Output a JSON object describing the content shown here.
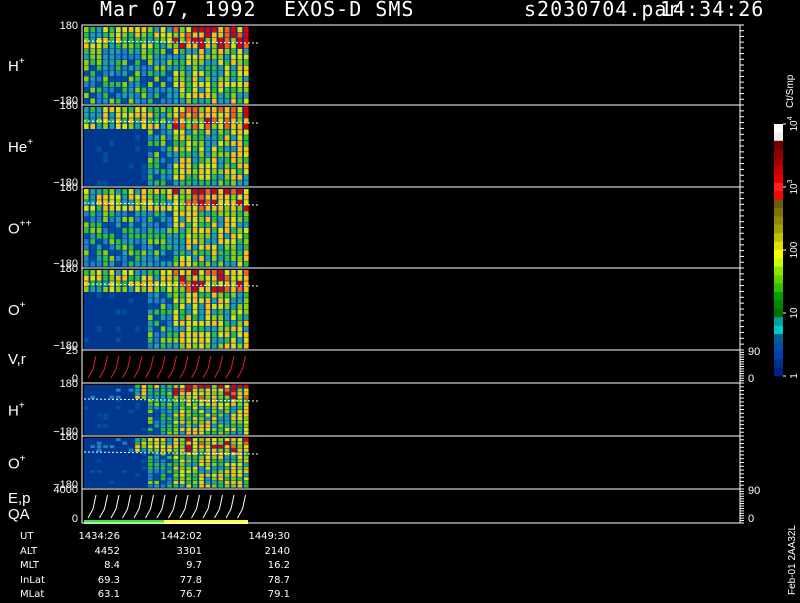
{
  "header": {
    "date": "Mar 07, 1992",
    "instrument": "EXOS-D SMS",
    "file": "s2030704.par",
    "time": "14:34:26"
  },
  "panels": [
    {
      "label": "H",
      "sup": "+",
      "ymax": "180",
      "ymin": "−180"
    },
    {
      "label": "He",
      "sup": "+",
      "ymax": "180",
      "ymin": "−180"
    },
    {
      "label": "O",
      "sup": "++",
      "ymax": "180",
      "ymin": "−180"
    },
    {
      "label": "O",
      "sup": "+",
      "ymax": "180",
      "ymin": "−180"
    },
    {
      "label": "V,r",
      "sup": "",
      "ymax": "25",
      "ymin": "0",
      "right_max": "90",
      "right_min": "0"
    },
    {
      "label": "H",
      "sup": "+",
      "ymax": "180",
      "ymin": "−180"
    },
    {
      "label": "O",
      "sup": "+",
      "ymax": "180",
      "ymin": "−180"
    },
    {
      "label": "E,p",
      "label2": "QA",
      "sup": "",
      "ymax": "4000",
      "ymin": "0",
      "right_max": "90",
      "right_min": "0"
    }
  ],
  "colorbar": {
    "unit": "Ct/Smp",
    "ticks": [
      "10",
      "10",
      "100",
      "10",
      "1"
    ],
    "tick_sups": [
      "4",
      "3",
      "",
      "",
      ""
    ],
    "levels": [
      10000,
      1000,
      100,
      10,
      1
    ],
    "colors": [
      "#ffffff",
      "#f0f0f0",
      "#700000",
      "#8a0000",
      "#a00000",
      "#c00000",
      "#e00000",
      "#ff2020",
      "#ff0000",
      "#6a5a10",
      "#807000",
      "#908800",
      "#a0a000",
      "#c0c000",
      "#e0e000",
      "#ffff00",
      "#c8ff00",
      "#90e000",
      "#60d000",
      "#30c000",
      "#00a000",
      "#008800",
      "#007000",
      "#00a0a0",
      "#00c8c8",
      "#006090",
      "#0050a0",
      "#0040b0",
      "#003090",
      "#002080"
    ]
  },
  "time_axis": {
    "labels": [
      "UT",
      "ALT",
      "MLT",
      "InLat",
      "MLat"
    ],
    "columns": [
      [
        "1434:26",
        "4452",
        "8.4",
        "69.3",
        "63.1"
      ],
      [
        "1442:02",
        "3301",
        "9.7",
        "77.8",
        "76.7"
      ],
      [
        "1449:30",
        "2140",
        "16.2",
        "78.7",
        "79.1"
      ]
    ]
  },
  "side_text": "Feb-01 2AA32L",
  "chart_data": {
    "type": "heatmap",
    "title": "Mar 07, 1992   EXOS-D SMS",
    "x": [
      "1434:26",
      "1442:02",
      "1449:30"
    ],
    "x_rows": {
      "ALT": [
        4452,
        3301,
        2140
      ],
      "MLT": [
        8.4,
        9.7,
        16.2
      ],
      "InLat": [
        69.3,
        77.8,
        78.7
      ],
      "MLat": [
        63.1,
        76.7,
        79.1
      ]
    },
    "series": [
      {
        "name": "H+",
        "ylim": [
          -180,
          180
        ]
      },
      {
        "name": "He+",
        "ylim": [
          -180,
          180
        ]
      },
      {
        "name": "O++",
        "ylim": [
          -180,
          180
        ]
      },
      {
        "name": "O+",
        "ylim": [
          -180,
          180
        ]
      },
      {
        "name": "V,r",
        "ylim": [
          0,
          25
        ],
        "right_ylim": [
          0,
          90
        ]
      },
      {
        "name": "H+",
        "ylim": [
          -180,
          180
        ]
      },
      {
        "name": "O+",
        "ylim": [
          -180,
          180
        ]
      },
      {
        "name": "E,p",
        "ylim": [
          0,
          4000
        ],
        "right_ylim": [
          0,
          90
        ]
      }
    ],
    "colorbar": {
      "label": "Ct/Smp",
      "scale": "log",
      "range": [
        1,
        10000
      ]
    }
  }
}
